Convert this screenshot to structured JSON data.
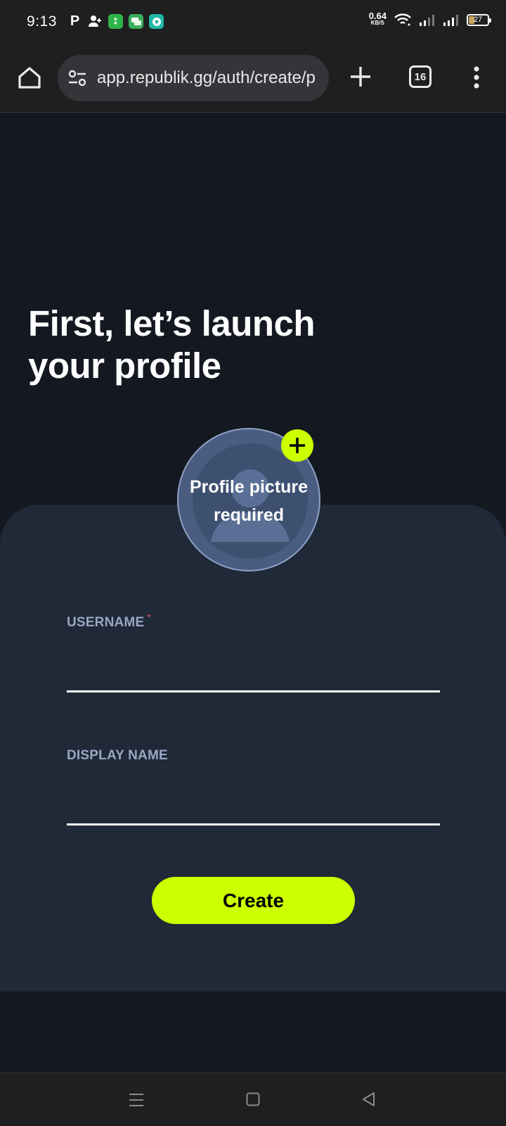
{
  "status_bar": {
    "time": "9:13",
    "net_speed_value": "0.64",
    "net_speed_unit": "KB/S",
    "battery_level": "27",
    "notification_icons": [
      "p-icon",
      "add-person-icon",
      "green-app-icon",
      "messages-icon",
      "teal-chat-icon"
    ]
  },
  "browser": {
    "url": "app.republik.gg/auth/create/p",
    "tab_count": "16"
  },
  "page": {
    "headline": "First, let’s launch your profile",
    "avatar_text": "Profile picture required",
    "username_label": "USERNAME",
    "username_required_mark": "*",
    "username_value": "",
    "display_name_label": "DISPLAY NAME",
    "display_name_value": "",
    "create_button": "Create"
  },
  "colors": {
    "accent": "#ccff00",
    "background": "#141820",
    "card": "#1f2937",
    "label": "#9aa6c2"
  }
}
